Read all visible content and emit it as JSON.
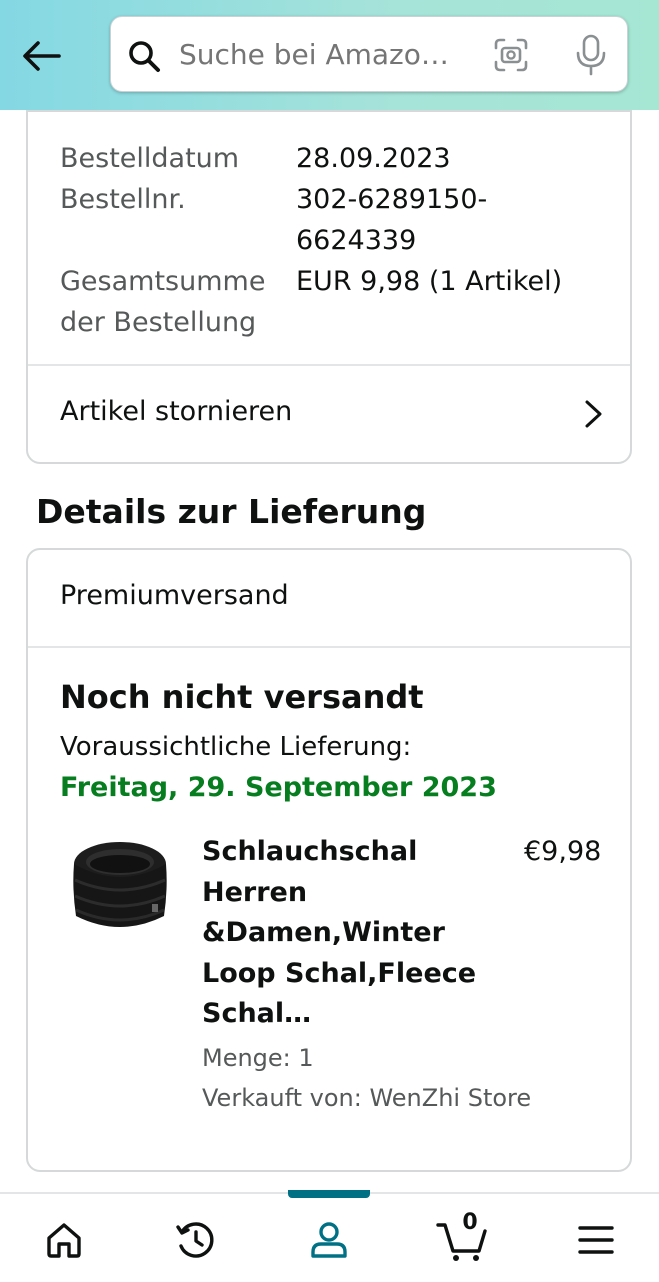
{
  "header": {
    "search": {
      "placeholder": "Suche bei Amazo…"
    }
  },
  "order_summary": {
    "date_label": "Bestelldatum",
    "date_value": "28.09.2023",
    "order_no_label": "Bestellnr.",
    "order_no_value_line1": "302-6289150-",
    "order_no_value_line2": "6624339",
    "total_label_line1": "Gesamtsumme",
    "total_label_line2": "der Bestellung",
    "total_value": "EUR 9,98 (1 Artikel)",
    "cancel_link": "Artikel stornieren"
  },
  "delivery": {
    "section_title": "Details zur Lieferung",
    "shipping_type": "Premiumversand",
    "status": "Noch nicht versandt",
    "eta_label": "Voraussichtliche Lieferung:",
    "eta_date": "Freitag, 29. September 2023",
    "item": {
      "title_lines": [
        "Schlauchschal",
        "Herren",
        "&Damen,Winter",
        "Loop Schal,Fleece",
        "Schal…"
      ],
      "price": "€9,98",
      "quantity": "Menge: 1",
      "seller": "Verkauft von: WenZhi Store"
    }
  },
  "bottom_nav": {
    "items": [
      "home",
      "history",
      "account",
      "cart",
      "menu"
    ],
    "active": "account",
    "cart_count": "0",
    "accent_color": "#007185"
  },
  "colors": {
    "eta_green": "#067d1e",
    "muted_text": "#565959"
  }
}
